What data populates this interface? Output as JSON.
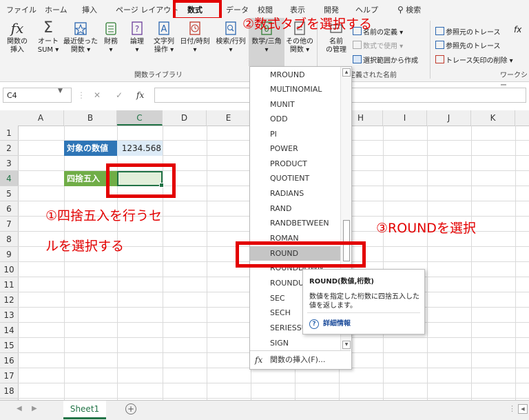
{
  "tabs": [
    "ファイル",
    "ホーム",
    "挿入",
    "ページ レイアウト",
    "数式",
    "データ",
    "校閲",
    "表示",
    "開発",
    "ヘルプ"
  ],
  "active_tab": "数式",
  "search_label": "検索",
  "ribbon": {
    "insert_function": "関数の\n挿入",
    "autosum": "オート\nSUM ▾",
    "recently_used": "最近使った\n関数 ▾",
    "financial": "財務\n▾",
    "logical": "論理\n▾",
    "text": "文字列\n操作 ▾",
    "datetime": "日付/時刻\n▾",
    "lookup": "検索/行列\n▾",
    "math_trig": "数学/三角\n▾",
    "more_functions": "その他の\n関数 ▾",
    "function_library_label": "関数ライブラリ",
    "name_manager": "名前\nの管理",
    "define_name": "名前の定義 ▾",
    "use_in_formula": "数式で使用 ▾",
    "create_from_selection": "選択範囲から作成",
    "defined_names_label": "定義された名前",
    "trace_precedents": "参照元のトレース",
    "trace_dependents": "参照先のトレース",
    "remove_arrows": "トレース矢印の削除 ▾",
    "worksheet_label": "ワークシー"
  },
  "formula_bar": {
    "name_box": "C4",
    "fx": "fx",
    "cancel": "✕",
    "enter": "✓"
  },
  "columns": [
    "A",
    "B",
    "C",
    "D",
    "E",
    "F",
    "G",
    "H",
    "I",
    "J",
    "K"
  ],
  "rows": [
    "1",
    "2",
    "3",
    "4",
    "5",
    "6",
    "7",
    "8",
    "9",
    "10",
    "11",
    "12",
    "13",
    "14",
    "15",
    "16",
    "17",
    "18"
  ],
  "cells": {
    "b2": "対象の数値",
    "c2": "1234.568",
    "b4": "四捨五入"
  },
  "dropdown": {
    "items": [
      "MROUND",
      "MULTINOMIAL",
      "MUNIT",
      "ODD",
      "PI",
      "POWER",
      "PRODUCT",
      "QUOTIENT",
      "RADIANS",
      "RAND",
      "RANDBETWEEN",
      "ROMAN",
      "ROUND",
      "ROUNDDOWN",
      "ROUNDUP",
      "SEC",
      "SECH",
      "SERIESSUM",
      "SIGN"
    ],
    "highlighted": "ROUND",
    "footer": "関数の挿入(F)..."
  },
  "tooltip": {
    "title": "ROUND(数値,桁数)",
    "description_line1": "数値を指定した桁数に四捨五入した",
    "description_line2": "値を返します。",
    "link": "詳細情報"
  },
  "annotations": {
    "step1_line1": "①四捨五入を行うセ",
    "step1_line2": "ルを選択する",
    "step2": "②数式タブを選択する",
    "step3": "③ROUNDを選択"
  },
  "sheet_tab": "Sheet1",
  "colors": {
    "annotation_red": "#e30000",
    "excel_green": "#217346",
    "label_blue_bg": "#2e75b6",
    "label_green_bg": "#70ad47",
    "value_cell_bg": "#ddebf7",
    "selected_cell_bg": "#e2efda"
  }
}
